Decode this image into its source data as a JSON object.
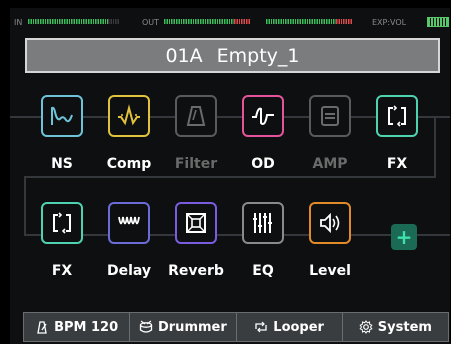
{
  "meters": {
    "in_label": "IN",
    "out_label": "OUT",
    "exp_label": "EXP:VOL"
  },
  "preset": {
    "number": "01A",
    "name": "Empty_1"
  },
  "chain_row1": [
    {
      "label": "NS",
      "icon": "noise-suppressor-icon",
      "color": "#6fc3d8",
      "active": true
    },
    {
      "label": "Comp",
      "icon": "compressor-icon",
      "color": "#e0c23c",
      "active": true
    },
    {
      "label": "Filter",
      "icon": "filter-icon",
      "color": "#5a5a5a",
      "active": false
    },
    {
      "label": "OD",
      "icon": "overdrive-icon",
      "color": "#e3549a",
      "active": true
    },
    {
      "label": "AMP",
      "icon": "amp-icon",
      "color": "#5a5a5a",
      "active": false
    },
    {
      "label": "FX",
      "icon": "fx-loop-icon",
      "color": "#4fd2b0",
      "active": true
    }
  ],
  "chain_row2": [
    {
      "label": "FX",
      "icon": "fx-loop-icon",
      "color": "#4fd2b0",
      "active": true
    },
    {
      "label": "Delay",
      "icon": "delay-icon",
      "color": "#6c6cd8",
      "active": true
    },
    {
      "label": "Reverb",
      "icon": "reverb-icon",
      "color": "#7a5ce0",
      "active": true
    },
    {
      "label": "EQ",
      "icon": "eq-icon",
      "color": "#8a8a8a",
      "active": true
    },
    {
      "label": "Level",
      "icon": "level-icon",
      "color": "#e08a2a",
      "active": true
    }
  ],
  "add_label": "+",
  "tabs": [
    {
      "label": "BPM 120",
      "icon": "metronome-icon"
    },
    {
      "label": "Drummer",
      "icon": "drum-icon"
    },
    {
      "label": "Looper",
      "icon": "loop-icon"
    },
    {
      "label": "System",
      "icon": "gear-icon"
    }
  ]
}
